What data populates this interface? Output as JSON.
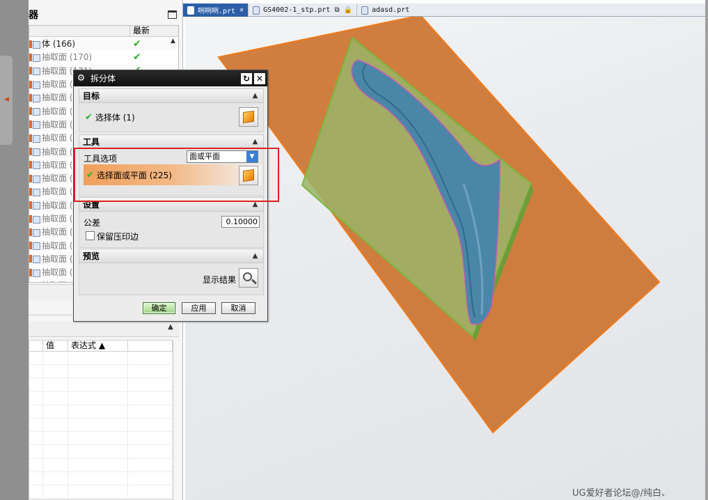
{
  "left_panel": {
    "fold_label": "",
    "navigator_title": "器",
    "header_latest": "最新",
    "rows": [
      {
        "label": "体 (166)"
      },
      {
        "label": "抽取面 (170)"
      },
      {
        "label": "抽取面 (171)"
      },
      {
        "label": "抽取面 ("
      },
      {
        "label": "抽取面 ("
      },
      {
        "label": "抽取面 ("
      },
      {
        "label": "抽取面 ("
      },
      {
        "label": "抽取面 ("
      },
      {
        "label": "抽取面 ("
      },
      {
        "label": "抽取面 ("
      },
      {
        "label": "抽取面 ("
      },
      {
        "label": "抽取面 ("
      },
      {
        "label": "抽取面 ("
      },
      {
        "label": "抽取面 ("
      },
      {
        "label": "抽取面 ("
      },
      {
        "label": "抽取面 ("
      },
      {
        "label": "抽取面 ("
      },
      {
        "label": "抽取面 ("
      },
      {
        "label": "抽取面 ("
      }
    ],
    "detail_headers": [
      "值",
      "表达式 ▲"
    ]
  },
  "tabs": [
    {
      "label": "咧咧咧.prt",
      "extra": "✕"
    },
    {
      "label": "GS4002-1_stp.prt",
      "extra": "⧉ 🔒"
    },
    {
      "label": "adasd.prt",
      "extra": ""
    }
  ],
  "dialog": {
    "title": "拆分体",
    "target_section": "目标",
    "select_body": "选择体 (1)",
    "tool_section": "工具",
    "tool_options_label": "工具选项",
    "tool_options_value": "面或平面",
    "select_face": "选择面或平面 (225)",
    "settings_section": "设置",
    "tolerance_label": "公差",
    "tolerance_value": "0.10000",
    "keep_imprint_label": "保留压印边",
    "keep_imprint_checked": false,
    "preview_section": "预览",
    "show_result_label": "显示结果",
    "ok_label": "确定",
    "apply_label": "应用",
    "cancel_label": "取消"
  },
  "watermark": "UG爱好者论坛@/纯白、"
}
